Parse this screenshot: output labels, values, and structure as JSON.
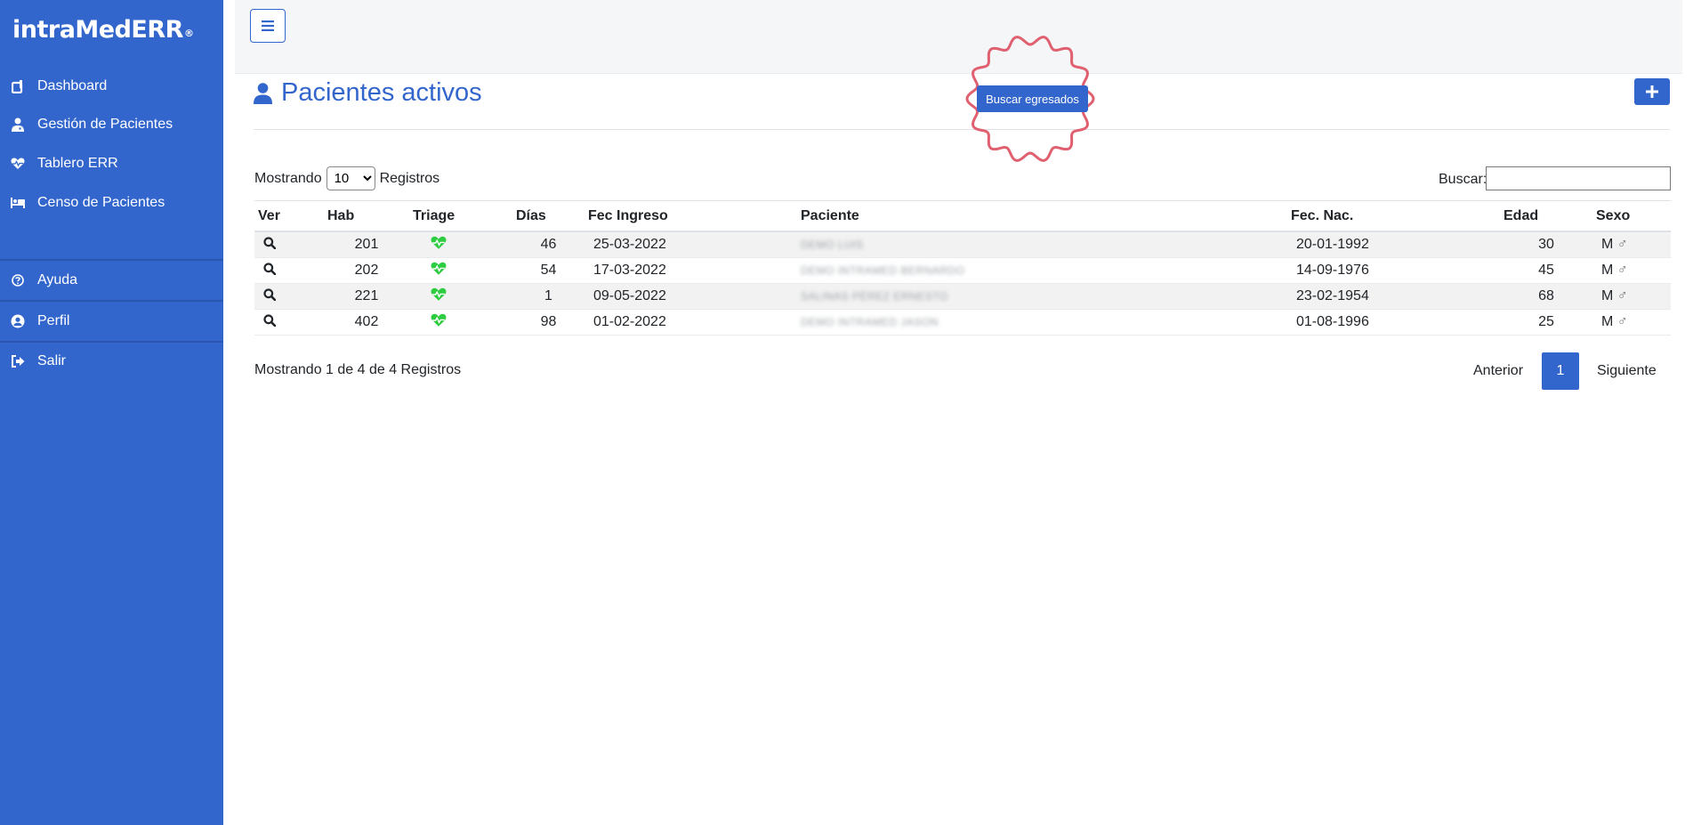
{
  "sidebar": {
    "brand": "intraMedERR",
    "brand_mark": "®",
    "items": [
      {
        "label": "Dashboard",
        "icon": "dashboard-icon"
      },
      {
        "label": "Gestión de Pacientes",
        "icon": "user-doctor-icon"
      },
      {
        "label": "Tablero ERR",
        "icon": "heart-pulse-icon"
      },
      {
        "label": "Censo de Pacientes",
        "icon": "bed-icon"
      }
    ],
    "bottom_items": [
      {
        "label": "Ayuda",
        "icon": "question-circle-icon"
      },
      {
        "label": "Perfil",
        "icon": "user-circle-icon"
      },
      {
        "label": "Salir",
        "icon": "sign-out-icon"
      }
    ]
  },
  "page": {
    "title": "Pacientes activos",
    "buscar_egresados": "Buscar egresados"
  },
  "table_controls": {
    "length_prefix": "Mostrando",
    "length_value": "10",
    "length_suffix": "Registros",
    "search_label": "Buscar:"
  },
  "table": {
    "columns": [
      "Ver",
      "Hab",
      "Triage",
      "Días",
      "Fec Ingreso",
      "Paciente",
      "Fec. Nac.",
      "Edad",
      "Sexo"
    ],
    "rows": [
      {
        "hab": "201",
        "dias": "46",
        "ingreso": "25-03-2022",
        "paciente": "DEMO LUIS",
        "nac": "20-01-1992",
        "edad": "30",
        "sexo": "M"
      },
      {
        "hab": "202",
        "dias": "54",
        "ingreso": "17-03-2022",
        "paciente": "DEMO INTRAMED BERNARDO",
        "nac": "14-09-1976",
        "edad": "45",
        "sexo": "M"
      },
      {
        "hab": "221",
        "dias": "1",
        "ingreso": "09-05-2022",
        "paciente": "SALINAS PÉREZ ERNESTO",
        "nac": "23-02-1954",
        "edad": "68",
        "sexo": "M"
      },
      {
        "hab": "402",
        "dias": "98",
        "ingreso": "01-02-2022",
        "paciente": "DEMO INTRAMED JASON",
        "nac": "01-08-1996",
        "edad": "25",
        "sexo": "M"
      }
    ]
  },
  "footer": {
    "info": "Mostrando 1 de 4 de 4 Registros",
    "prev": "Anterior",
    "current_page": "1",
    "next": "Siguiente"
  },
  "colors": {
    "primary": "#3366cc",
    "triage": "#2ecc40",
    "stamp": "#e06070"
  }
}
